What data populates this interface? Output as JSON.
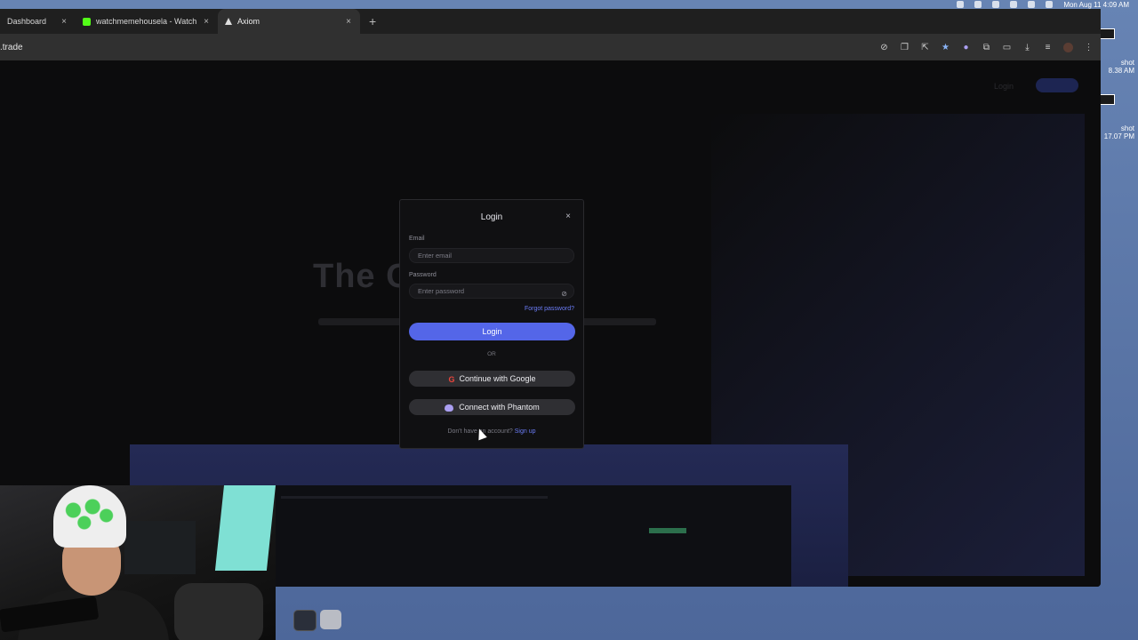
{
  "menubar": {
    "clock": "Mon Aug 11  4:09 AM"
  },
  "desktop": {
    "icons": [
      {
        "label1": "shot",
        "label2": "8.38 AM"
      },
      {
        "label1": "shot",
        "label2": "17.07 PM"
      }
    ]
  },
  "browser": {
    "tabs": [
      {
        "label": "Dashboard",
        "favicon": "dashboard-icon"
      },
      {
        "label": "watchmemehousela - Watch",
        "favicon": "kick-icon"
      },
      {
        "label": "Axiom",
        "favicon": "axiom-icon"
      }
    ],
    "new_tab": "+",
    "url": ".trade"
  },
  "page": {
    "hero_title": "The C            DeFi",
    "nav_login": "Login"
  },
  "modal": {
    "title": "Login",
    "close": "×",
    "email_label": "Email",
    "email_placeholder": "Enter email",
    "password_label": "Password",
    "password_placeholder": "Enter password",
    "forgot": "Forgot password?",
    "login_button": "Login",
    "or": "OR",
    "google_button": "Continue with Google",
    "phantom_button": "Connect with Phantom",
    "signup_prompt": "Don't have an account?",
    "signup_link": "Sign up"
  },
  "colors": {
    "accent": "#5466e8",
    "link": "#6b7cf6",
    "background": "#0c0c0d"
  }
}
